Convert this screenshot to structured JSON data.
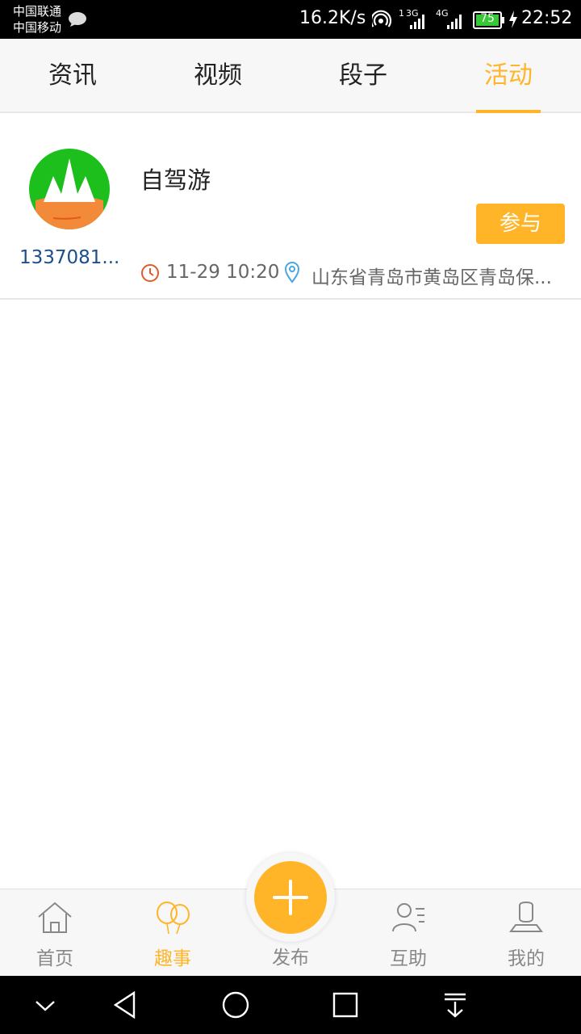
{
  "status_bar": {
    "carrier_1": "中国联通",
    "carrier_2": "中国移动",
    "net_speed": "16.2K/s",
    "sim1_network": "3G",
    "sim1_slot": "1",
    "sim2_network": "4G",
    "battery_level": "75",
    "time": "22:52",
    "battery_color": "#37c837"
  },
  "tabs": [
    {
      "label": "资讯"
    },
    {
      "label": "视频"
    },
    {
      "label": "段子"
    },
    {
      "label": "活动"
    }
  ],
  "active_tab": "活动",
  "accent_color": "#ffb527",
  "activity": {
    "username": "1337081...",
    "title": "自驾游",
    "join_label": "参与",
    "time": "11-29 10:20",
    "location": "山东省青岛市黄岛区青岛保..."
  },
  "bottom_nav": [
    {
      "label": "首页",
      "icon": "home-icon"
    },
    {
      "label": "趣事",
      "icon": "balloons-icon"
    },
    {
      "label": "发布",
      "icon": "plus-icon"
    },
    {
      "label": "互助",
      "icon": "contacts-icon"
    },
    {
      "label": "我的",
      "icon": "profile-icon"
    }
  ],
  "active_nav": "趣事"
}
